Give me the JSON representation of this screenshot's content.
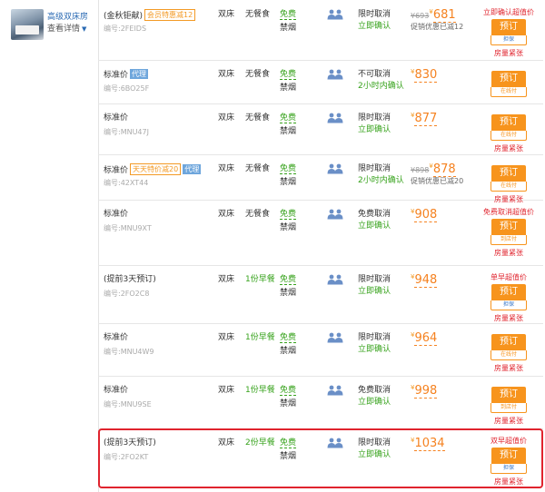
{
  "room": {
    "name": "高级双床房",
    "detail_label": "查看详情"
  },
  "rows": [
    {
      "name": "(金秋钜献)",
      "tag_orange": "会员特惠减12",
      "tag_blue": "",
      "code": "编号:2FEIDS",
      "bed": "双床",
      "meal": "无餐食",
      "wifi": "免费",
      "smoke": "禁烟",
      "cancel": "限时取消",
      "confirm": "立即确认",
      "old_price": "¥693",
      "currency": "¥",
      "price": "681",
      "promo": "促销优惠已减12",
      "deal": "立即确认超值价",
      "book": "预订",
      "pay": "担保",
      "tight": "房量紧张"
    },
    {
      "name": "标准价",
      "tag_orange": "",
      "tag_blue": "代理",
      "code": "编号:6BO25F",
      "bed": "双床",
      "meal": "无餐食",
      "wifi": "免费",
      "smoke": "禁烟",
      "cancel": "不可取消",
      "confirm": "2小时内确认",
      "old_price": "",
      "currency": "¥",
      "price": "830",
      "promo": "",
      "deal": "",
      "book": "预订",
      "pay": "在线付",
      "tight": ""
    },
    {
      "name": "标准价",
      "tag_orange": "",
      "tag_blue": "",
      "code": "编号:MNU47J",
      "bed": "双床",
      "meal": "无餐食",
      "wifi": "免费",
      "smoke": "禁烟",
      "cancel": "限时取消",
      "confirm": "立即确认",
      "old_price": "",
      "currency": "¥",
      "price": "877",
      "promo": "",
      "deal": "",
      "book": "预订",
      "pay": "在线付",
      "tight": "房量紧张"
    },
    {
      "name": "标准价",
      "tag_orange": "天天特价减20",
      "tag_blue": "代理",
      "code": "编号:42XT44",
      "bed": "双床",
      "meal": "无餐食",
      "wifi": "免费",
      "smoke": "禁烟",
      "cancel": "限时取消",
      "confirm": "2小时内确认",
      "old_price": "¥898",
      "currency": "¥",
      "price": "878",
      "promo": "促销优惠已减20",
      "deal": "",
      "book": "预订",
      "pay": "在线付",
      "tight": "房量紧张"
    },
    {
      "name": "标准价",
      "tag_orange": "",
      "tag_blue": "",
      "code": "编号:MNU9XT",
      "bed": "双床",
      "meal": "无餐食",
      "wifi": "免费",
      "smoke": "禁烟",
      "cancel": "免费取消",
      "confirm": "立即确认",
      "old_price": "",
      "currency": "¥",
      "price": "908",
      "promo": "",
      "deal": "免费取消超值价",
      "book": "预订",
      "pay": "到店付",
      "tight": "房量紧张"
    },
    {
      "name": "(提前3天预订)",
      "tag_orange": "",
      "tag_blue": "",
      "code": "编号:2FO2C8",
      "bed": "双床",
      "meal": "1份早餐",
      "wifi": "免费",
      "smoke": "禁烟",
      "cancel": "限时取消",
      "confirm": "立即确认",
      "old_price": "",
      "currency": "¥",
      "price": "948",
      "promo": "",
      "deal": "单早超值价",
      "book": "预订",
      "pay": "担保",
      "tight": "房量紧张"
    },
    {
      "name": "标准价",
      "tag_orange": "",
      "tag_blue": "",
      "code": "编号:MNU4W9",
      "bed": "双床",
      "meal": "1份早餐",
      "wifi": "免费",
      "smoke": "禁烟",
      "cancel": "限时取消",
      "confirm": "立即确认",
      "old_price": "",
      "currency": "¥",
      "price": "964",
      "promo": "",
      "deal": "",
      "book": "预订",
      "pay": "在线付",
      "tight": "房量紧张"
    },
    {
      "name": "标准价",
      "tag_orange": "",
      "tag_blue": "",
      "code": "编号:MNU9SE",
      "bed": "双床",
      "meal": "1份早餐",
      "wifi": "免费",
      "smoke": "禁烟",
      "cancel": "免费取消",
      "confirm": "立即确认",
      "old_price": "",
      "currency": "¥",
      "price": "998",
      "promo": "",
      "deal": "",
      "book": "预订",
      "pay": "到店付",
      "tight": "房量紧张"
    },
    {
      "name": "(提前3天预订)",
      "tag_orange": "",
      "tag_blue": "",
      "code": "编号:2FO2KT",
      "bed": "双床",
      "meal": "2份早餐",
      "wifi": "免费",
      "smoke": "禁烟",
      "cancel": "限时取消",
      "confirm": "立即确认",
      "old_price": "",
      "currency": "¥",
      "price": "1034",
      "promo": "",
      "deal": "双早超值价",
      "book": "预订",
      "pay": "担保",
      "tight": "房量紧张"
    }
  ],
  "colors": {
    "accent": "#f7941d",
    "price": "#f58220",
    "green": "#36a21b",
    "red": "#e0242e",
    "blue_tag": "#6ea6dc",
    "link": "#2a6ab3"
  },
  "icons": {
    "guests": "two-guests-icon",
    "detail": "chevron-down-icon"
  }
}
